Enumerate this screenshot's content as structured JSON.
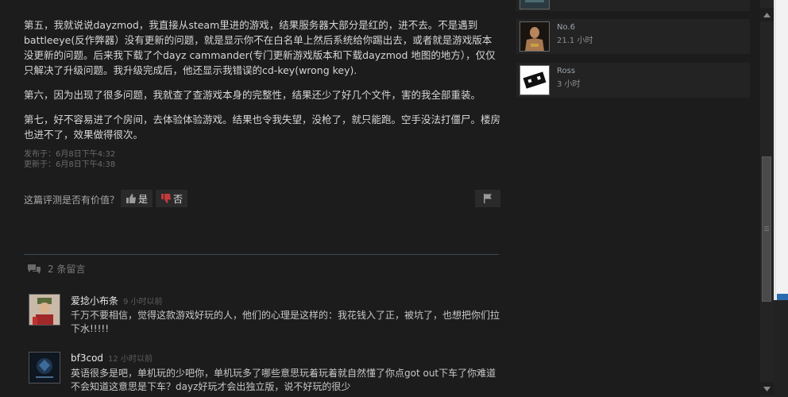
{
  "review": {
    "paragraphs": [
      "第五，我就说说dayzmod，我直接从steam里进的游戏，结果服务器大部分是红的，进不去。不是遇到battleeye(反作弊器）没有更新的问题，就是显示你不在白名单上然后系统给你踢出去，或者就是游戏版本没更新的问题。后来我下载了个dayz cammander(专门更新游戏版本和下载dayzmod 地图的地方），仅仅只解决了升级问题。我升级完成后，他还显示我错误的cd-key(wrong key).",
      "第六，因为出现了很多问题，我就查了查游戏本身的完整性，结果还少了好几个文件，害的我全部重装。",
      "第七，好不容易进了个房间，去体验体验游戏。结果也令我失望，没枪了，就只能跑。空手没法打僵尸。楼房也进不了，效果做得很次。"
    ],
    "posted": "发布于：6月8日下午4:32",
    "updated": "更新于：6月8日下午4:38"
  },
  "helpful": {
    "question": "这篇评测是否有价值？",
    "yes_label": "是",
    "no_label": "否"
  },
  "comments": {
    "count_label": "2 条留言",
    "items": [
      {
        "author": "爱捻小布条",
        "time": "9 小时以前",
        "text": "千万不要相信，觉得这款游戏好玩的人，他们的心理是这样的：我花钱入了正，被坑了，也想把你们拉下水!!!!!"
      },
      {
        "author": "bf3cod",
        "time": "12 小时以前",
        "text": "英语很多是吧，单机玩的少吧你，单机玩多了哪些意思玩着玩着就自然懂了你点got out下车了你难道不会知道这意思是下车？dayz好玩才会出独立版，说不好玩的很少"
      }
    ]
  },
  "friends": [
    {
      "name": "No.6",
      "hours": "21.1 小时"
    },
    {
      "name": "Ross",
      "hours": "3 小时"
    }
  ],
  "colors": {
    "background": "#1c1c1c",
    "text": "#d6d6d6",
    "vote_no": "#c23a3a",
    "divider": "#3a4a5c"
  }
}
